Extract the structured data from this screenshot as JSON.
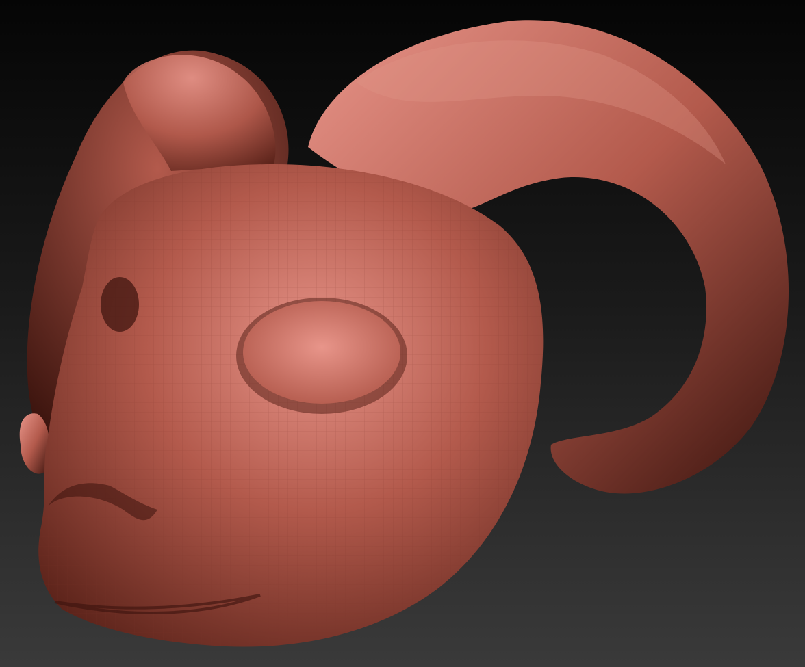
{
  "viewport": {
    "bg_top": "#050505",
    "bg_bottom": "#3a3a3a"
  },
  "model": {
    "base_color": "#b35a4c",
    "highlight_color": "#e8958a",
    "shadow_color": "#5a2219",
    "deep_shadow_color": "#3a130d",
    "wire_color": "#7a3328"
  }
}
